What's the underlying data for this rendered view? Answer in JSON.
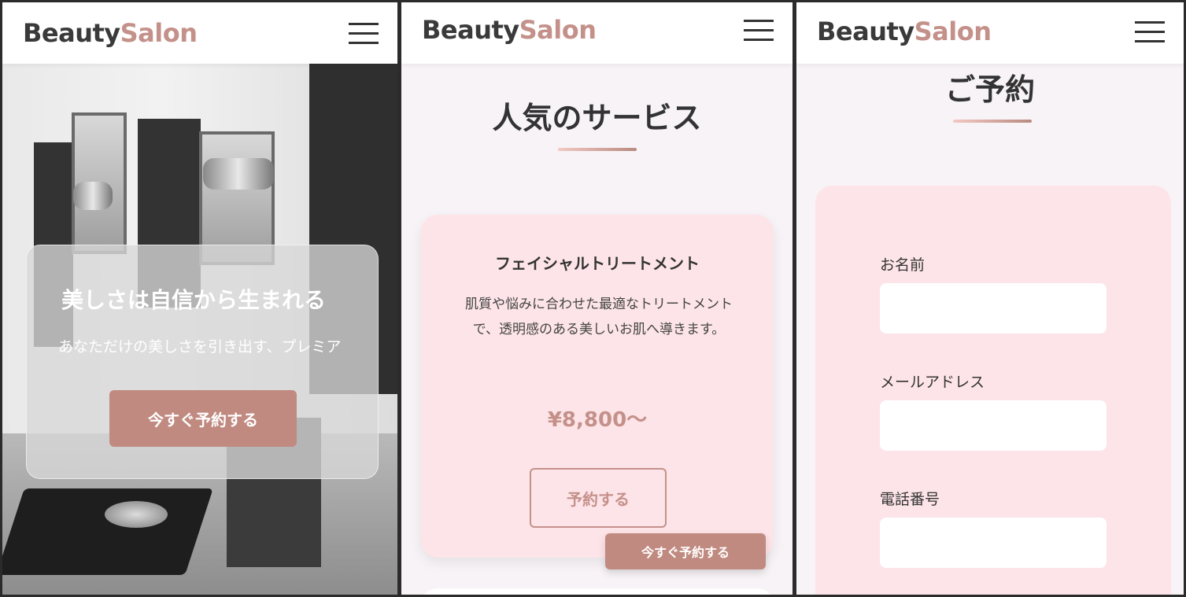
{
  "brand": {
    "part1": "Beauty",
    "part2": "Salon"
  },
  "colors": {
    "accent": "#c4918a",
    "button": "#c08a80",
    "card_bg": "#fde4e8",
    "page_bg": "#f7f3f6"
  },
  "hero": {
    "title": "美しさは自信から生まれる",
    "subtitle": "あなただけの美しさを引き出す、プレミア",
    "cta": "今すぐ予約する"
  },
  "services": {
    "title": "人気のサービス",
    "card": {
      "name": "フェイシャルトリートメント",
      "description": "肌質や悩みに合わせた最適なトリートメントで、透明感のある美しいお肌へ導きます。",
      "price": "¥8,800〜",
      "button": "予約する"
    },
    "floating_cta": "今すぐ予約する"
  },
  "reservation": {
    "title": "ご予約",
    "fields": [
      {
        "label": "お名前"
      },
      {
        "label": "メールアドレス"
      },
      {
        "label": "電話番号"
      }
    ]
  },
  "icons": {
    "menu": "hamburger-menu-icon"
  }
}
